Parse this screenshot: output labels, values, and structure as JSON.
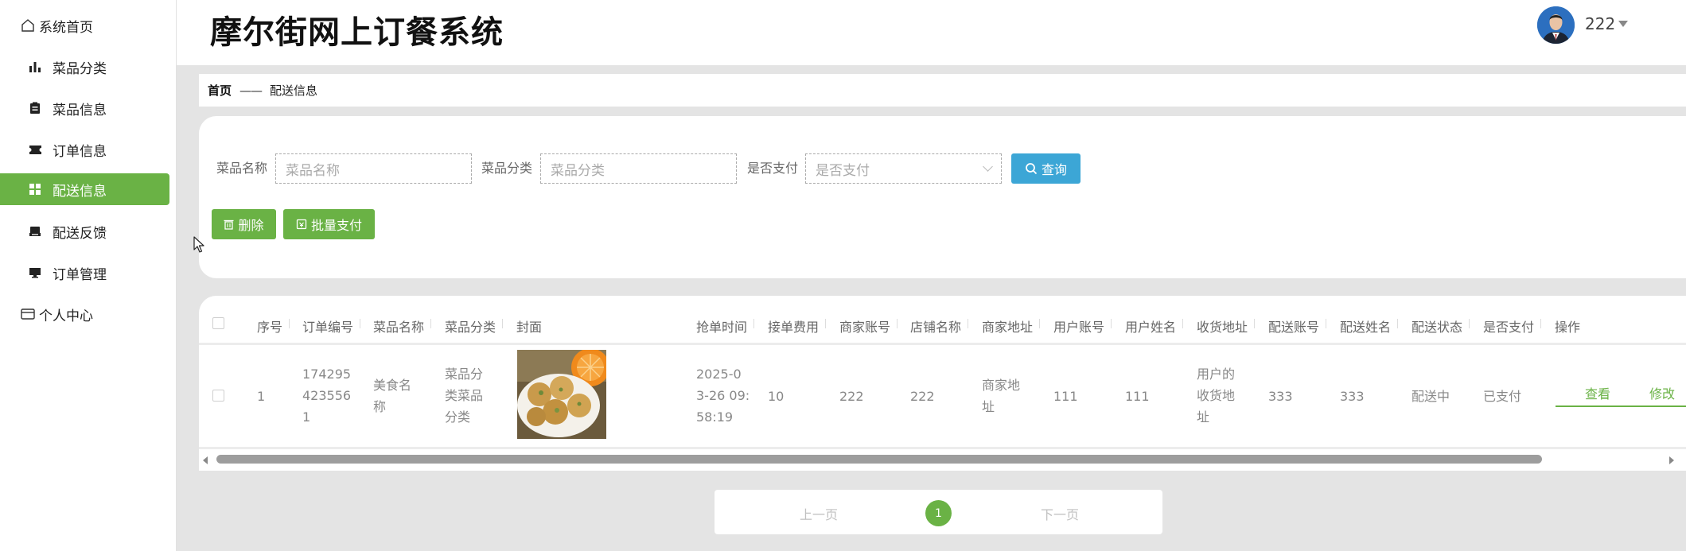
{
  "app": {
    "title": "摩尔街网上订餐系统"
  },
  "user": {
    "name": "222"
  },
  "sidebar": {
    "items": [
      {
        "label": "系统首页",
        "icon": "home-icon"
      },
      {
        "label": "菜品分类",
        "icon": "bar-chart-icon"
      },
      {
        "label": "菜品信息",
        "icon": "clipboard-icon"
      },
      {
        "label": "订单信息",
        "icon": "ticket-icon"
      },
      {
        "label": "配送信息",
        "icon": "grid-icon",
        "active": true
      },
      {
        "label": "配送反馈",
        "icon": "printer-icon"
      },
      {
        "label": "订单管理",
        "icon": "monitor-icon"
      },
      {
        "label": "个人中心",
        "icon": "card-icon"
      }
    ]
  },
  "breadcrumb": {
    "home": "首页",
    "separator": "——",
    "current": "配送信息"
  },
  "search": {
    "dish_name_label": "菜品名称",
    "dish_name_placeholder": "菜品名称",
    "category_label": "菜品分类",
    "category_placeholder": "菜品分类",
    "paid_label": "是否支付",
    "paid_placeholder": "是否支付",
    "query_label": "查询"
  },
  "actions": {
    "delete_label": "删除",
    "batch_pay_label": "批量支付"
  },
  "table": {
    "headers": [
      "序号",
      "订单编号",
      "菜品名称",
      "菜品分类",
      "封面",
      "抢单时间",
      "接单费用",
      "商家账号",
      "店铺名称",
      "商家地址",
      "用户账号",
      "用户姓名",
      "收货地址",
      "配送账号",
      "配送姓名",
      "配送状态",
      "是否支付",
      "操作"
    ],
    "rows": [
      {
        "index": "1",
        "order_no": [
          "174295",
          "423556",
          "1"
        ],
        "dish_name": [
          "美食名",
          "称"
        ],
        "category": [
          "菜品分",
          "类菜品",
          "分类"
        ],
        "grab_time": [
          "2025-0",
          "3-26 09:",
          "58:19"
        ],
        "fee": "10",
        "merchant_account": "222",
        "shop_name": "222",
        "merchant_address": [
          "商家地",
          "址"
        ],
        "user_account": "111",
        "user_name": "111",
        "delivery_address": [
          "用户的",
          "收货地",
          "址"
        ],
        "courier_account": "333",
        "courier_name": "333",
        "delivery_status": "配送中",
        "paid": "已支付",
        "view_label": "查看",
        "edit_label": "修改"
      }
    ]
  },
  "pagination": {
    "prev_label": "上一页",
    "current_page": "1",
    "next_label": "下一页"
  },
  "colors": {
    "accent": "#6ab245",
    "query": "#3ca6d6",
    "background": "#e4e4e4"
  }
}
